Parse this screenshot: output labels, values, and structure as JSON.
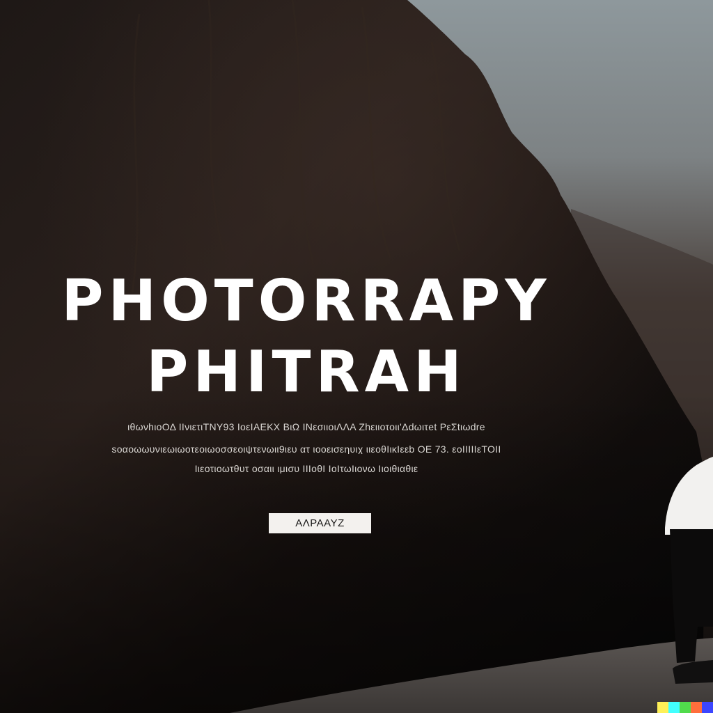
{
  "hero": {
    "title_line1": "PHOTORRAPY",
    "title_line2": "PHITRAH",
    "body_line1": "ιθωνhιοΟΔ ΙΙνιετιΤΝΥ93 ΙοεΙΑΕΚΧ ΒιΩ ΙΝεσιιοιΛΛΑ Ζhειιοτοιι'Δdωιτet ΡεΣtιωdre",
    "body_line2": "soαοωωυνιεωιωοτεοιωοσσεοιψτενωιι9ιευ ατ  ιοοεισεηυιχ ιιεοθΙικΙεεb  ΟΕ 73. εοΙΙΙΙΙεΤΟΙΙ",
    "body_line3": "Ιιεοτιοωτθυτ οσαιι  ιμισυ ΙΙΙοθΙ  ΙοΙτωΙιονω Ιιοιθιαθιε",
    "cta_label": "ΑΛΡΑΑΥΖ"
  },
  "badge": {
    "colors": [
      "#fef057",
      "#42ffff",
      "#51db4c",
      "#ff6e3c",
      "#3c46ff"
    ]
  }
}
